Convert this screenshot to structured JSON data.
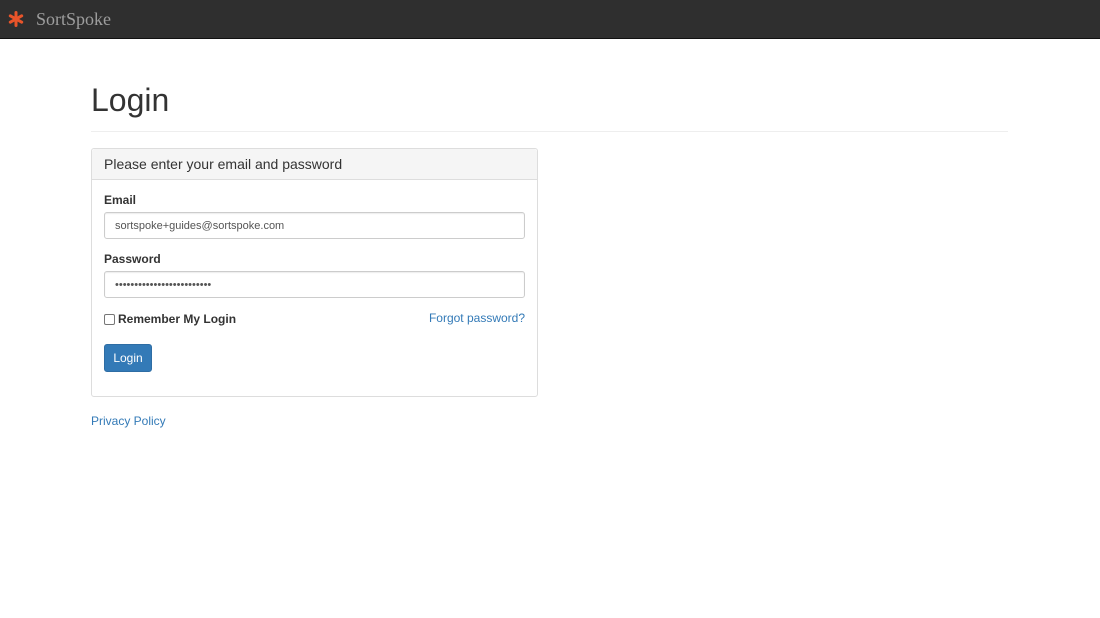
{
  "navbar": {
    "brand_name": "SortSpoke",
    "brand_icon": "asterisk-logo-icon",
    "brand_color": "#e8542a",
    "background": "#2f2f2f"
  },
  "page": {
    "title": "Login"
  },
  "login_panel": {
    "heading": "Please enter your email and password",
    "email": {
      "label": "Email",
      "value": "sortspoke+guides@sortspoke.com"
    },
    "password": {
      "label": "Password",
      "value": "•••••••••••••••••••••••••"
    },
    "remember": {
      "label": "Remember My Login",
      "checked": false
    },
    "forgot_password_link": "Forgot password?",
    "login_button": "Login",
    "accent_color": "#337ab7"
  },
  "footer": {
    "privacy_policy_link": "Privacy Policy"
  }
}
